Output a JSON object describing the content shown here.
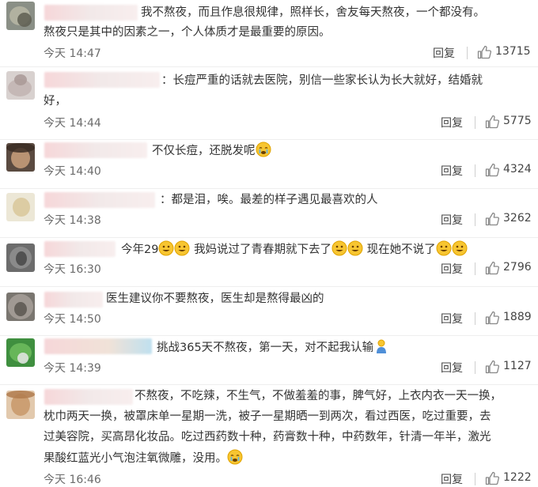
{
  "comments": [
    {
      "lines": [
        "我不熬夜，而且作息很规律，照样长，舍友每天熬夜，一个都没有。",
        "熬夜只是其中的因素之一，个人体质才是最重要的原因。"
      ],
      "time": "今天 14:47",
      "reply": "回复",
      "likes": "13715"
    },
    {
      "lines": [
        "：长痘严重的话就去医院，别信一些家长认为长大就好，结婚就",
        "好，"
      ],
      "time": "今天 14:44",
      "reply": "回复",
      "likes": "5775"
    },
    {
      "lines": [
        "不仅长痘，还脱发呢"
      ],
      "time": "今天 14:40",
      "reply": "回复",
      "likes": "4324",
      "emoji": "crying-face-emoji"
    },
    {
      "lines": [
        "：都是泪，唉。最差的样子遇见最喜欢的人"
      ],
      "time": "今天 14:38",
      "reply": "回复",
      "likes": "3262"
    },
    {
      "segments": [
        "今年29",
        "我妈说过了青春期就下去了",
        "现在她不说了"
      ],
      "time": "今天 16:30",
      "reply": "回复",
      "likes": "2796",
      "emoji": "grin-face-emoji"
    },
    {
      "lines": [
        "医生建议你不要熬夜，医生却是熬得最凶的"
      ],
      "time": "今天 14:50",
      "reply": "回复",
      "likes": "1889"
    },
    {
      "lines": [
        "挑战365天不熬夜，第一天，对不起我认输"
      ],
      "time": "今天 14:39",
      "reply": "回复",
      "likes": "1127",
      "emoji": "person-emoji"
    },
    {
      "lines": [
        "不熬夜，不吃辣，不生气，不做羞羞的事，脾气好，上衣内衣一天一换，",
        "枕巾两天一换，被罩床单一星期一洗，被子一星期晒一到两次，看过西医，吃过重要，去",
        "过美容院，买高昂化妆品。吃过西药数十种，药膏数十种，中药数年，针清一年半，激光",
        "果酸红蓝光小气泡注氧微雕，没用。"
      ],
      "time": "今天 16:46",
      "reply": "回复",
      "likes": "1222",
      "emoji": "crying-face-emoji"
    }
  ],
  "colors": {
    "text": "#333333",
    "meta": "#6b6b6b",
    "divider": "#eeeeee",
    "emoji_yellow": "#f7c531"
  }
}
